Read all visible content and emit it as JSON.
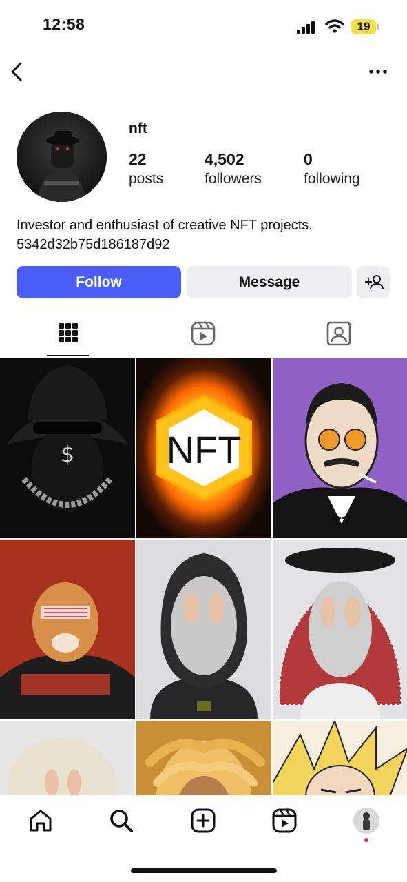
{
  "status_bar": {
    "time": "12:58",
    "battery": "19"
  },
  "profile": {
    "username": "nft",
    "stats": [
      {
        "value": "22",
        "label": "posts"
      },
      {
        "value": "4,502",
        "label": "followers"
      },
      {
        "value": "0",
        "label": "following"
      }
    ],
    "bio": [
      "Investor and enthusiast of creative NFT projects.",
      "5342d32b75d186187d92"
    ]
  },
  "actions": {
    "follow": "Follow",
    "message": "Message"
  },
  "tabs": [
    "grid-icon",
    "reels-icon",
    "tagged-icon"
  ],
  "grid": {
    "posts": [
      {
        "kind": "bucket-hat-masked-figure"
      },
      {
        "kind": "nft-hexagon-logo",
        "text": "NFT"
      },
      {
        "kind": "bitcoin-glasses-man"
      },
      {
        "kind": "tiger-with-shades"
      },
      {
        "kind": "hooded-balaclava-character"
      },
      {
        "kind": "keffiyeh-balaclava-character"
      },
      {
        "kind": "cream-character"
      },
      {
        "kind": "dreadlocks-character"
      },
      {
        "kind": "anime-character"
      }
    ]
  },
  "colors": {
    "follow": "#4a5ef7",
    "secondary_button": "#eeeef0",
    "notification_dot": "#e0245e"
  },
  "nav": [
    "home-icon",
    "search-icon",
    "create-icon",
    "reels-icon",
    "profile-avatar"
  ]
}
